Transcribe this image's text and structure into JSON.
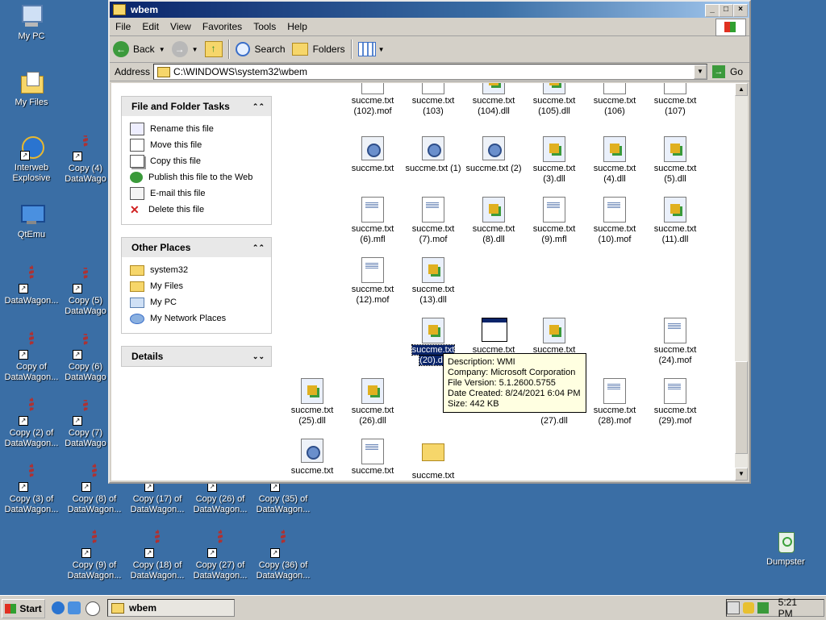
{
  "desktop": {
    "icons": [
      {
        "label": "My PC"
      },
      {
        "label": "My Files"
      },
      {
        "label": "Interweb\nExplosive"
      },
      {
        "label": "QtEmu"
      },
      {
        "label": "DataWagon..."
      },
      {
        "label": "Copy of\nDataWagon..."
      },
      {
        "label": "Copy (2) of\nDataWagon..."
      },
      {
        "label": "Copy (3) of\nDataWagon..."
      },
      {
        "label": "Copy (4)\nDataWago"
      },
      {
        "label": "Copy (5)\nDataWago"
      },
      {
        "label": "Copy (6)\nDataWago"
      },
      {
        "label": "Copy (7)\nDataWago"
      },
      {
        "label": "Copy (8) of\nDataWagon..."
      },
      {
        "label": "Copy (9) of\nDataWagon..."
      },
      {
        "label": "Copy (17) of\nDataWagon..."
      },
      {
        "label": "Copy (18) of\nDataWagon..."
      },
      {
        "label": "Copy (26) of\nDataWagon..."
      },
      {
        "label": "Copy (27) of\nDataWagon..."
      },
      {
        "label": "Copy (35) of\nDataWagon..."
      },
      {
        "label": "Copy (36) of\nDataWagon..."
      },
      {
        "label": "Dumpster"
      }
    ]
  },
  "window": {
    "title": "wbem",
    "controls": {
      "minimize": "_",
      "maximize": "□",
      "close": "×"
    },
    "menu": [
      "File",
      "Edit",
      "View",
      "Favorites",
      "Tools",
      "Help"
    ],
    "toolbar": {
      "back": "Back",
      "search": "Search",
      "folders": "Folders"
    },
    "address": {
      "label": "Address",
      "path": "C:\\WINDOWS\\system32\\wbem",
      "go": "Go"
    }
  },
  "tasks_panel": {
    "title": "File and Folder Tasks",
    "items": [
      "Rename this file",
      "Move this file",
      "Copy this file",
      "Publish this file to the Web",
      "E-mail this file",
      "Delete this file"
    ]
  },
  "places_panel": {
    "title": "Other Places",
    "items": [
      "system32",
      "My Files",
      "My PC",
      "My Network Places"
    ]
  },
  "details_panel": {
    "title": "Details"
  },
  "files": [
    {
      "line1": "succme.txt",
      "line2": "(102).mof"
    },
    {
      "line1": "succme.txt",
      "line2": "(103)"
    },
    {
      "line1": "succme.txt",
      "line2": "(104).dll"
    },
    {
      "line1": "succme.txt",
      "line2": "(105).dll"
    },
    {
      "line1": "succme.txt",
      "line2": "(106)"
    },
    {
      "line1": "succme.txt",
      "line2": "(107)"
    },
    {
      "line1": "succme.txt",
      "line2": ""
    },
    {
      "line1": "succme.txt (1)",
      "line2": ""
    },
    {
      "line1": "succme.txt (2)",
      "line2": ""
    },
    {
      "line1": "succme.txt",
      "line2": "(3).dll"
    },
    {
      "line1": "succme.txt",
      "line2": "(4).dll"
    },
    {
      "line1": "succme.txt",
      "line2": "(5).dll"
    },
    {
      "line1": "succme.txt",
      "line2": "(6).mfl"
    },
    {
      "line1": "succme.txt",
      "line2": "(7).mof"
    },
    {
      "line1": "succme.txt",
      "line2": "(8).dll"
    },
    {
      "line1": "succme.txt",
      "line2": "(9).mfl"
    },
    {
      "line1": "succme.txt",
      "line2": "(10).mof"
    },
    {
      "line1": "succme.txt",
      "line2": "(11).dll"
    },
    {
      "line1": "succme.txt",
      "line2": "(12).mof"
    },
    {
      "line1": "succme.txt",
      "line2": "(13).dll"
    },
    {
      "line1": "succme.txt",
      "line2": "(20).dll"
    },
    {
      "line1": "succme.txt",
      "line2": ""
    },
    {
      "line1": "succme.txt",
      "line2": ""
    },
    {
      "line1": "succme.txt",
      "line2": "(24).mof"
    },
    {
      "line1": "succme.txt",
      "line2": "(25).dll"
    },
    {
      "line1": "succme.txt",
      "line2": "(26).dll"
    },
    {
      "line1": "succme.txt",
      "line2": "(27).dll"
    },
    {
      "line1": "succme.txt",
      "line2": "(28).mof"
    },
    {
      "line1": "succme.txt",
      "line2": "(29).mof"
    },
    {
      "line1": "succme.txt",
      "line2": ""
    },
    {
      "line1": "succme.txt",
      "line2": ""
    },
    {
      "line1": "succme.txt",
      "line2": ""
    }
  ],
  "tooltip": {
    "description": "Description: WMI",
    "company": "Company: Microsoft Corporation",
    "version": "File Version: 5.1.2600.5755",
    "created": "Date Created: 8/24/2021 6:04 PM",
    "size": "Size: 442 KB"
  },
  "taskbar": {
    "start": "Start",
    "task": "wbem",
    "clock": "5:21 PM"
  },
  "colors": {
    "desktop": "#3a6ea5",
    "titlebar": "#0a246a",
    "tooltip": "#ffffe1"
  }
}
